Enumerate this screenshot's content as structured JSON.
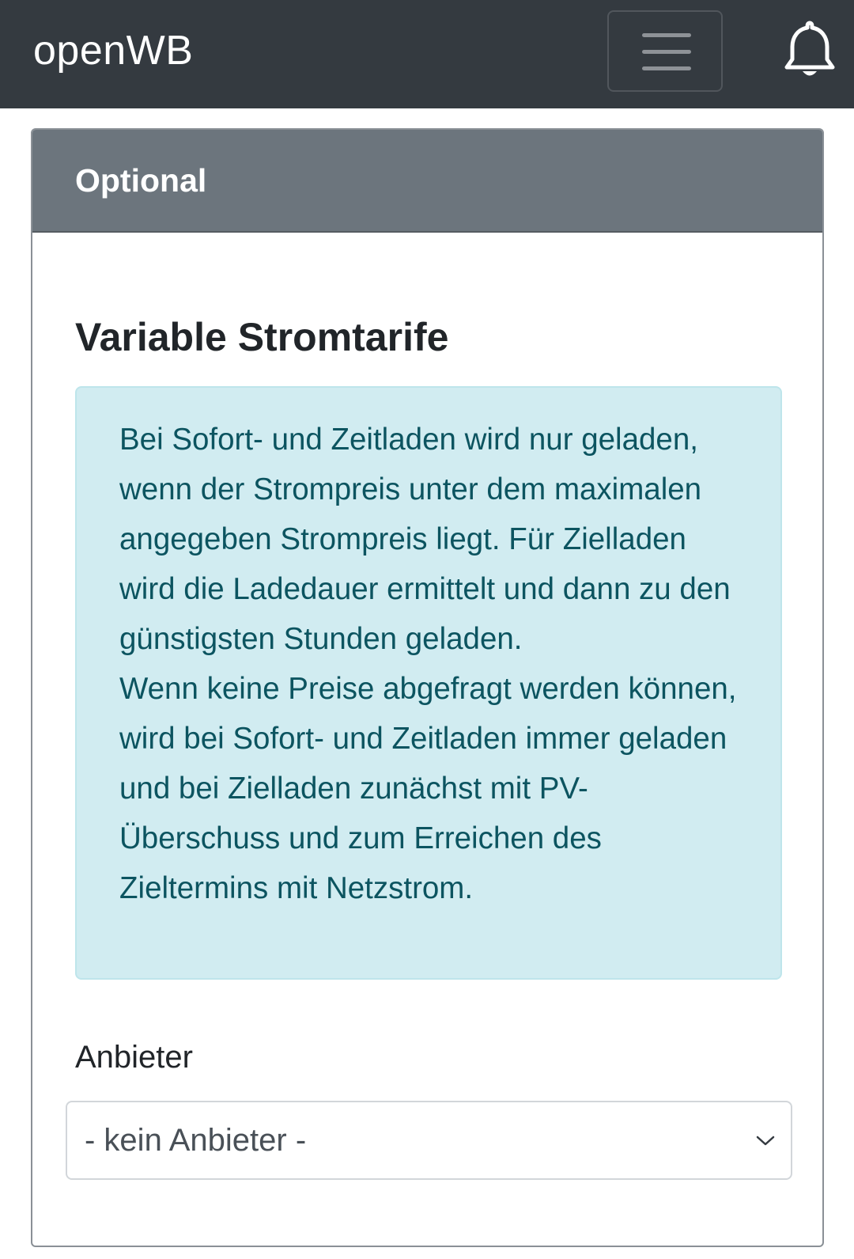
{
  "navbar": {
    "brand": "openWB",
    "menu_icon": "hamburger-menu-icon",
    "notification_icon": "bell-icon"
  },
  "card": {
    "header_title": "Optional",
    "section_title": "Variable Stromtarife",
    "info_paragraphs": [
      "Bei Sofort- und Zeitladen wird nur geladen, wenn der Strompreis unter dem maximalen angegeben Strompreis liegt. Für Zielladen wird die Ladedauer ermittelt und dann zu den günstigsten Stunden geladen.",
      "Wenn keine Preise abgefragt werden können, wird bei Sofort- und Zeitladen immer geladen und bei Zielladen zunächst mit PV-Überschuss und zum Erreichen des Zieltermins mit Netzstrom."
    ],
    "provider": {
      "label": "Anbieter",
      "selected": "- kein Anbieter -",
      "dropdown_icon": "chevron-down-icon"
    }
  },
  "colors": {
    "navbar_bg": "#343a40",
    "card_header_bg": "#6c757d",
    "alert_bg": "#d1ecf1",
    "alert_text": "#0c5460"
  }
}
